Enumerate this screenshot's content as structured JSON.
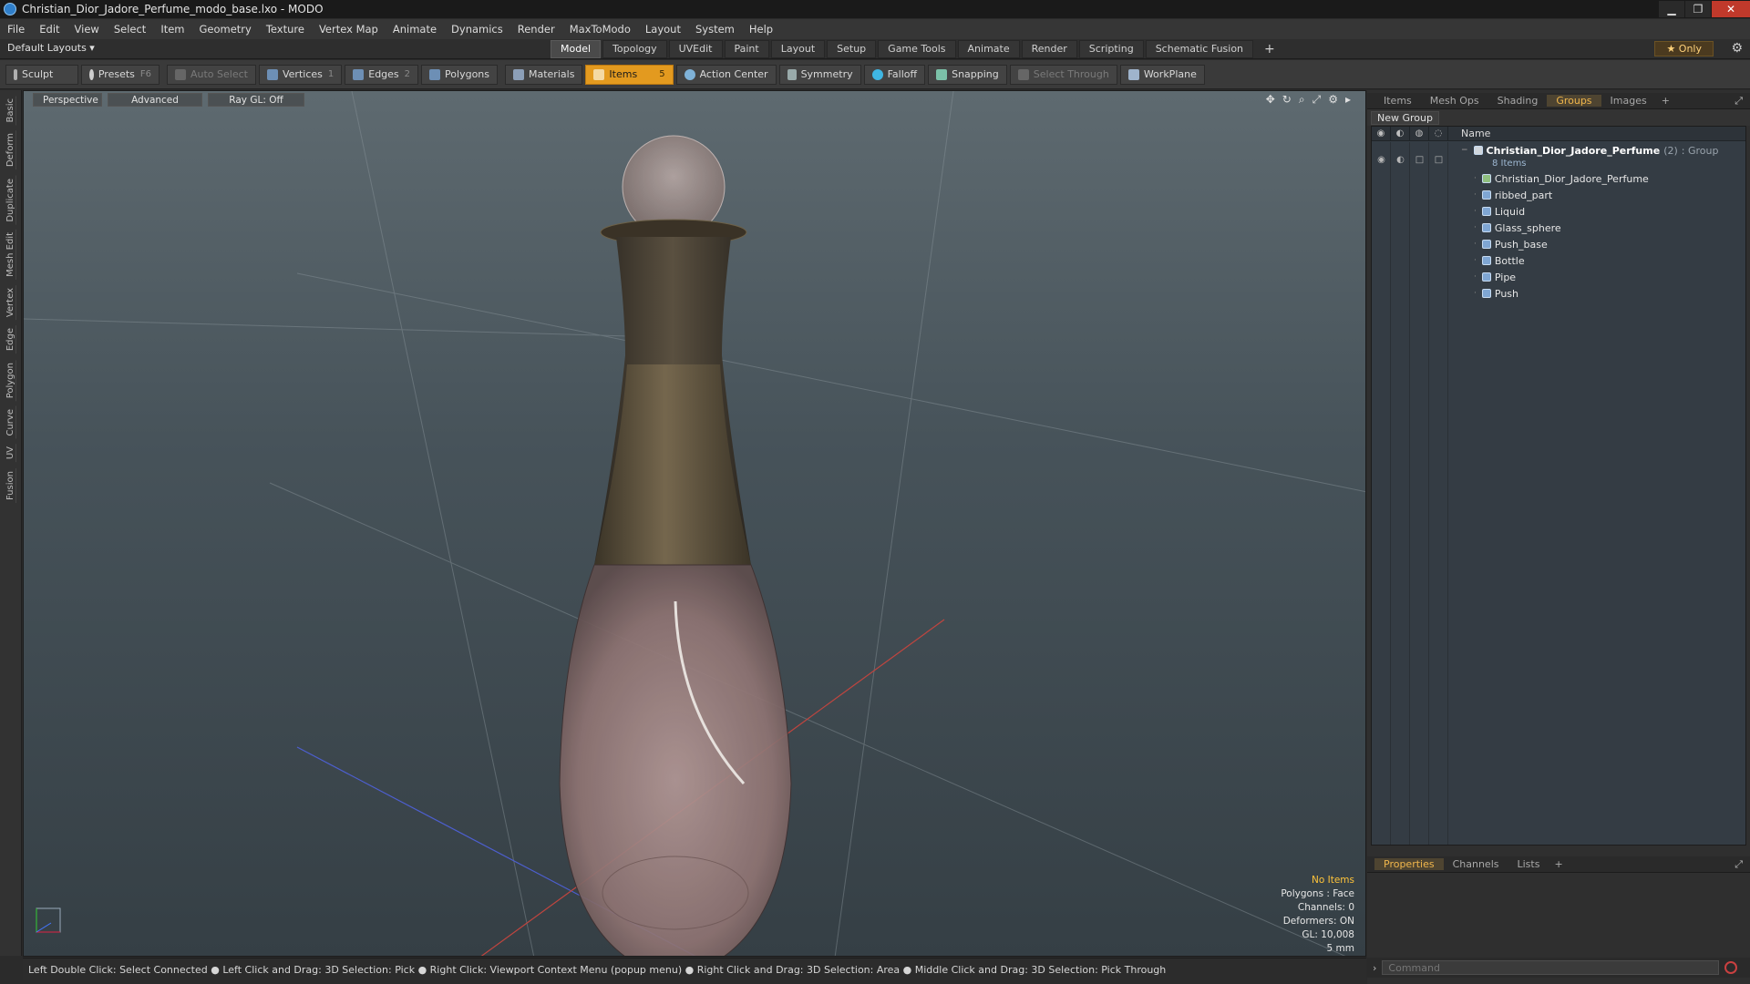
{
  "window": {
    "title": "Christian_Dior_Jadore_Perfume_modo_base.lxo - MODO",
    "min": "▁",
    "max": "❐",
    "close": "✕"
  },
  "menu": [
    "File",
    "Edit",
    "View",
    "Select",
    "Item",
    "Geometry",
    "Texture",
    "Vertex Map",
    "Animate",
    "Dynamics",
    "Render",
    "MaxToModo",
    "Layout",
    "System",
    "Help"
  ],
  "layoutbar": {
    "layouts": "Default Layouts ▾",
    "tabs": [
      "Model",
      "Topology",
      "UVEdit",
      "Paint",
      "Layout",
      "Setup",
      "Game Tools",
      "Animate",
      "Render",
      "Scripting",
      "Schematic Fusion"
    ],
    "active_tab": "Model",
    "add": "+",
    "only": "★ Only",
    "gear": "⚙"
  },
  "toolbar": {
    "sculpt": "Sculpt",
    "presets": "Presets",
    "presets_key": "F6",
    "auto_select": "Auto Select",
    "vertices": "Vertices",
    "vertices_count": "1",
    "edges": "Edges",
    "edges_count": "2",
    "polygons": "Polygons",
    "materials": "Materials",
    "items": "Items",
    "items_count": "5",
    "action_center": "Action Center",
    "symmetry": "Symmetry",
    "falloff": "Falloff",
    "snapping": "Snapping",
    "select_through": "Select Through",
    "workplane": "WorkPlane"
  },
  "leftstrip": [
    "Basic",
    "Deform",
    "Duplicate",
    "Mesh Edit",
    "Vertex",
    "Edge",
    "Polygon",
    "Curve",
    "UV",
    "Fusion"
  ],
  "viewport": {
    "perspective": "Perspective",
    "advanced": "Advanced",
    "raygl": "Ray GL: Off",
    "info": {
      "no_items": "No Items",
      "polygons": "Polygons : Face",
      "channels": "Channels: 0",
      "deformers": "Deformers: ON",
      "gl": "GL: 10,008",
      "scale": "5 mm"
    }
  },
  "statusbar": "Left Double Click: Select Connected ● Left Click and Drag: 3D Selection: Pick ● Right Click: Viewport Context Menu (popup menu) ● Right Click and Drag: 3D Selection: Area ● Middle Click and Drag: 3D Selection: Pick Through",
  "rightpanel": {
    "tabs": [
      "Items",
      "Mesh Ops",
      "Shading",
      "Groups",
      "Images"
    ],
    "active_tab": "Groups",
    "new_group": "New Group",
    "col_name": "Name",
    "group": {
      "name": "Christian_Dior_Jadore_Perfume",
      "count": "(2)",
      "type": ": Group",
      "sub": "8 Items"
    },
    "items": [
      "Christian_Dior_Jadore_Perfume",
      "ribbed_part",
      "Liquid",
      "Glass_sphere",
      "Push_base",
      "Bottle",
      "Pipe",
      "Push"
    ],
    "bottom_tabs": [
      "Properties",
      "Channels",
      "Lists"
    ],
    "bottom_active": "Properties",
    "command_placeholder": "Command"
  },
  "colors": {
    "accent": "#e39a1f",
    "selected_tab": "#f0b64c",
    "info_highlight": "#ffc43a"
  }
}
